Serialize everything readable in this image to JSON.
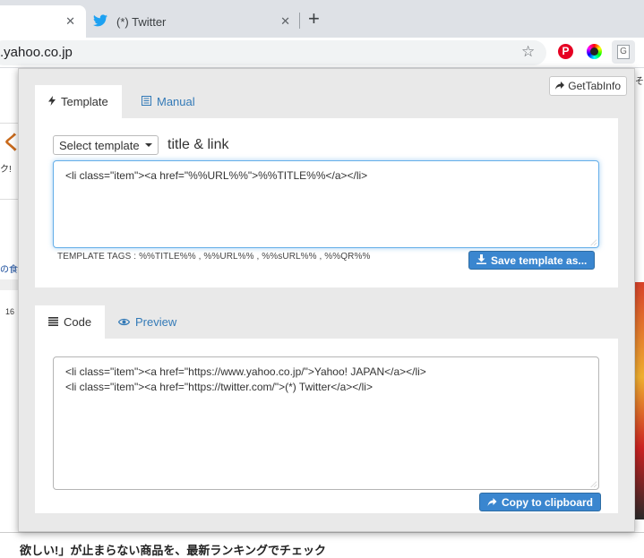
{
  "browser": {
    "tabs": [
      {
        "label": "",
        "close": "✕"
      },
      {
        "label": "(*) Twitter",
        "close": "✕"
      }
    ],
    "new_tab": "+",
    "url": ".yahoo.co.jp",
    "star": "☆",
    "ext_pinterest": "P",
    "ext_g": "G"
  },
  "background_page": {
    "left_fragments": [
      "ク!",
      "の食",
      "16"
    ],
    "right_fragment": "そ",
    "bottom_text": "欲しい!」が止まらない商品を、最新ランキングでチェック"
  },
  "popup": {
    "gettabinfo_label": "GetTabInfo",
    "template_panel": {
      "tabs": [
        {
          "label": "Template",
          "icon": "bolt-icon",
          "active": true
        },
        {
          "label": "Manual",
          "icon": "book-icon",
          "active": false
        }
      ],
      "select_label": "Select template",
      "template_name": "title & link",
      "template_value": "<li class=\"item\"><a href=\"%%URL%%\">%%TITLE%%</a></li>",
      "tags_text": "TEMPLATE TAGS : %%TITLE%% , %%URL%% , %%sURL%% , %%QR%%",
      "save_label": "Save template as..."
    },
    "code_panel": {
      "tabs": [
        {
          "label": "Code",
          "icon": "list-icon",
          "active": true
        },
        {
          "label": "Preview",
          "icon": "eye-icon",
          "active": false
        }
      ],
      "code_value": "<li class=\"item\"><a href=\"https://www.yahoo.co.jp/\">Yahoo! JAPAN</a></li>\n<li class=\"item\"><a href=\"https://twitter.com/\">(*) Twitter</a></li>",
      "copy_label": "Copy to clipboard"
    }
  }
}
